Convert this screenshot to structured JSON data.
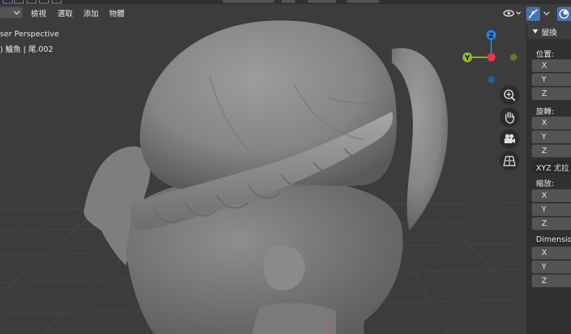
{
  "header": {
    "menus": [
      "檢視",
      "選取",
      "添加",
      "物體"
    ]
  },
  "viewport": {
    "view_name": "ser Perspective",
    "object_info": ") 鱸魚 | 尾.002"
  },
  "gizmo": {
    "z_label": "Z",
    "y_label": "Y",
    "colors": {
      "x": "#e8364e",
      "y": "#8bbb25",
      "z": "#2a7fdc"
    }
  },
  "nav_buttons": [
    "zoom-icon",
    "hand-icon",
    "camera-icon",
    "grid-icon"
  ],
  "npanel": {
    "section_title": "變換",
    "location_label": "位置:",
    "location_fields": [
      "X",
      "Y",
      "Z"
    ],
    "rotation_label": "旋轉:",
    "rotation_fields": [
      "X",
      "Y",
      "Z"
    ],
    "rotation_mode": "XYZ 尤拉",
    "scale_label": "縮放:",
    "scale_fields": [
      "X",
      "Y",
      "Z"
    ],
    "dimensions_label": "Dimension",
    "dimensions_fields": [
      "X",
      "Y",
      "Z"
    ]
  }
}
